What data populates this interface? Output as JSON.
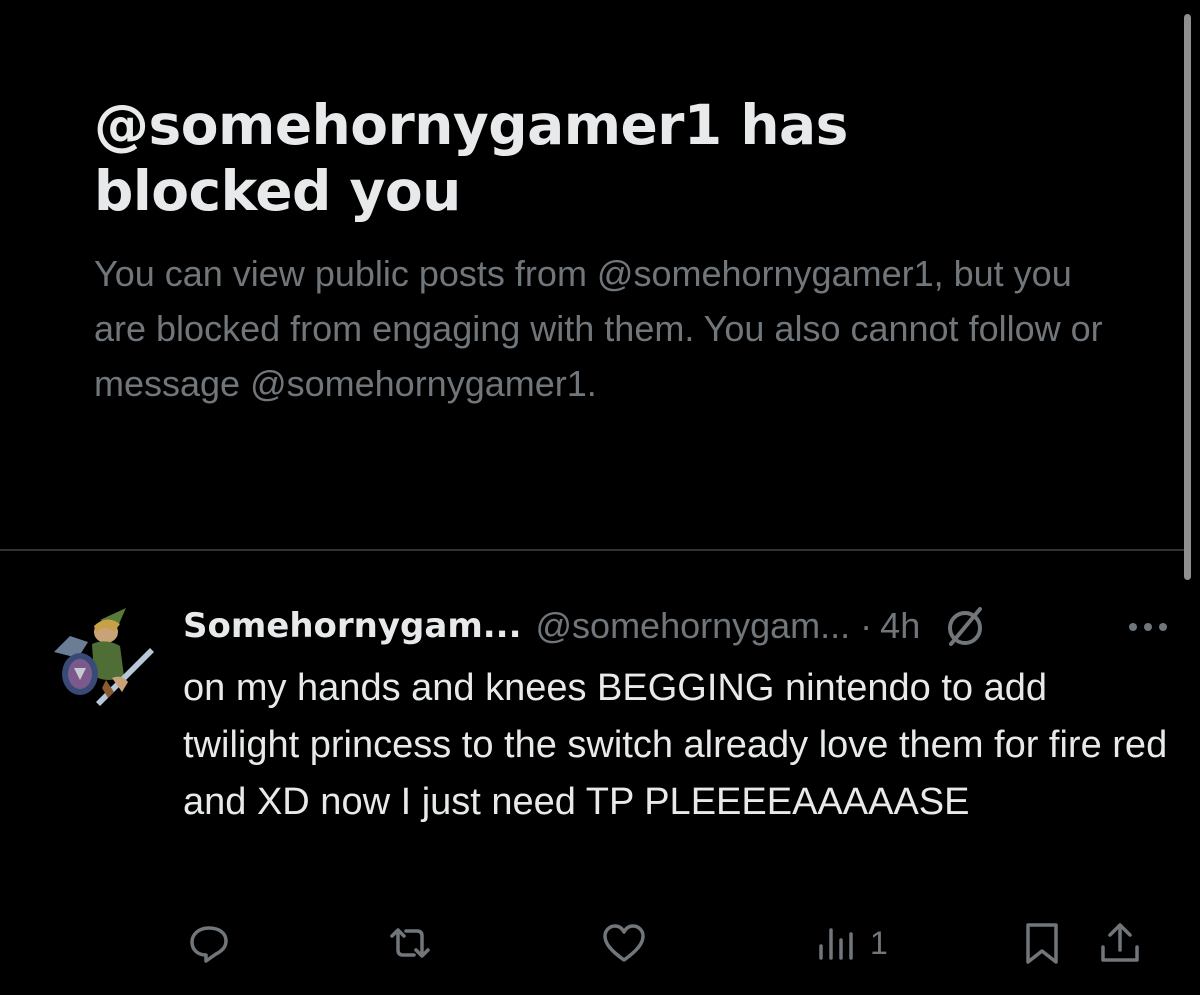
{
  "blocked_notice": {
    "title": "@somehornygamer1 has blocked you",
    "description": "You can view public posts from @somehornygamer1, but you are blocked from engaging with them. You also cannot follow or message @somehornygamer1."
  },
  "post": {
    "display_name": "Somehornygam...",
    "handle": "@somehornygam...",
    "separator": "·",
    "timestamp": "4h",
    "text": "on my hands and knees BEGGING nintendo to add twilight princess to the switch already love them for fire red and XD now I just need TP PLEEEEAAAAASE",
    "views": "1",
    "icons": {
      "visibility": "eye-slash-icon",
      "more": "more-dots-icon",
      "reply": "reply-icon",
      "repost": "repost-icon",
      "like": "heart-icon",
      "views": "views-chart-icon",
      "bookmark": "bookmark-icon",
      "share": "share-icon"
    }
  },
  "colors": {
    "background": "#000000",
    "primary_text": "#e7e9ea",
    "secondary_text": "#71767b",
    "divider": "#2f3336"
  }
}
